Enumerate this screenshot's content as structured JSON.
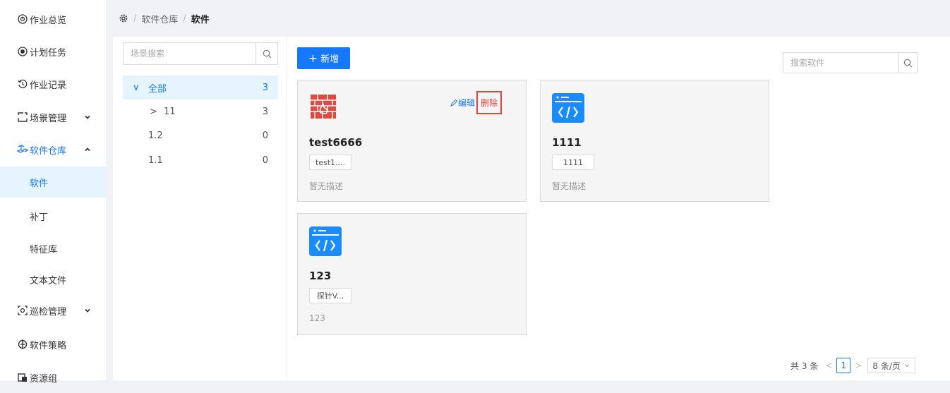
{
  "sidebar": {
    "items": [
      {
        "label": "作业总览",
        "icon": "gauge-icon"
      },
      {
        "label": "计划任务",
        "icon": "target-icon"
      },
      {
        "label": "作业记录",
        "icon": "history-icon"
      },
      {
        "label": "场景管理",
        "icon": "scene-icon",
        "chevron": "down"
      },
      {
        "label": "软件仓库",
        "icon": "repo-icon",
        "chevron": "up"
      },
      {
        "label": "软件"
      },
      {
        "label": "补丁"
      },
      {
        "label": "特征库"
      },
      {
        "label": "文本文件"
      },
      {
        "label": "巡检管理",
        "icon": "scan-icon",
        "chevron": "down"
      },
      {
        "label": "软件策略",
        "icon": "policy-icon"
      },
      {
        "label": "资源组",
        "icon": "resource-icon"
      }
    ]
  },
  "breadcrumb": {
    "root_icon": "settings-icon",
    "parent": "软件仓库",
    "separator": "/",
    "current": "软件"
  },
  "tree": {
    "search_placeholder": "场景搜索",
    "rows": [
      {
        "label": "全部",
        "count": "3",
        "arrow": "∨"
      },
      {
        "label": "11",
        "count": "3",
        "arrow": ">"
      },
      {
        "label": "1.2",
        "count": "0"
      },
      {
        "label": "1.1",
        "count": "0"
      }
    ]
  },
  "toolbar": {
    "add_label": "新增",
    "add_glyph": "+",
    "search_placeholder": "搜索软件"
  },
  "cards": [
    {
      "title": "test6666",
      "tag": "test1....",
      "desc": "暂无描述",
      "icon": "firewall-icon",
      "edit_label": "编辑",
      "delete_label": "删除"
    },
    {
      "title": "1111",
      "tag": "1111",
      "desc": "暂无描述",
      "icon": "code-window-icon"
    },
    {
      "title": "123",
      "tag": "探针V...",
      "desc": "123",
      "icon": "code-window-icon"
    }
  ],
  "pagination": {
    "total": "共 3 条",
    "current_page": "1",
    "page_size": "8 条/页"
  },
  "colors": {
    "primary": "#1677ff",
    "danger": "#e8423c",
    "firewall": "#e04a3f"
  }
}
